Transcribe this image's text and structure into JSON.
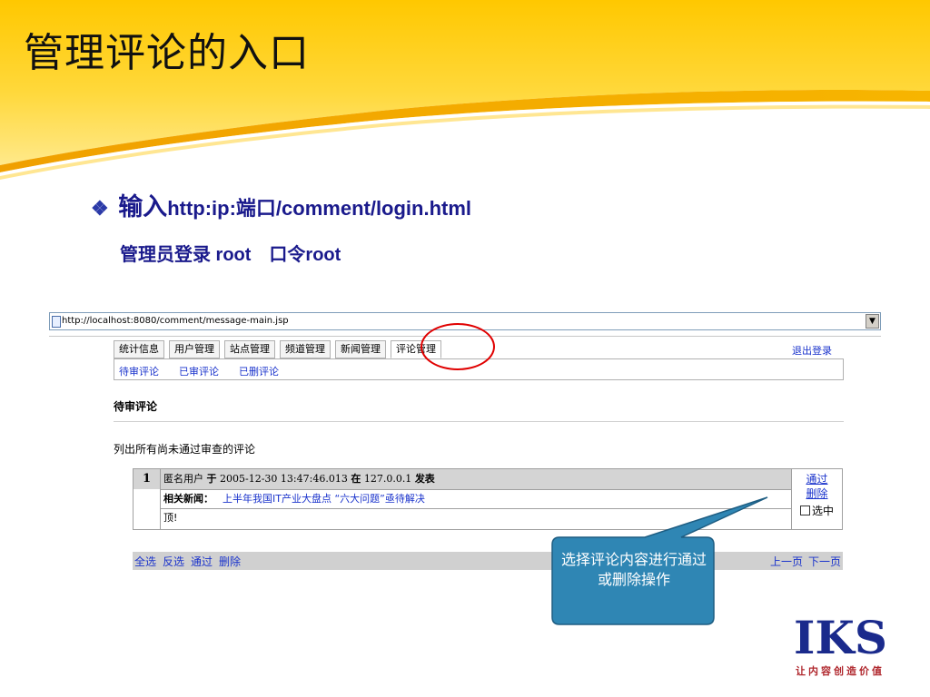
{
  "slide": {
    "title": "管理评论的入口",
    "bullet_word": "输入",
    "bullet_url": "http:ip:端口/comment/login.html",
    "admin_line": "管理员登录 root　口令root"
  },
  "browser": {
    "address": "http://localhost:8080/comment/message-main.jsp",
    "address_dropdown_glyph": "▼"
  },
  "tabs": [
    "统计信息",
    "用户管理",
    "站点管理",
    "频道管理",
    "新闻管理",
    "评论管理"
  ],
  "active_tab": "评论管理",
  "logout": "退出登录",
  "subnav": [
    "待审评论",
    "已审评论",
    "已删评论"
  ],
  "section": {
    "title": "待审评论",
    "desc": "列出所有尚未通过审查的评论"
  },
  "comment": {
    "number": "1",
    "user": "匿名用户",
    "at_word": "于",
    "time": "2005-12-30 13:47:46.013",
    "in_word": "在",
    "ip": "127.0.0.1",
    "post_word": "发表",
    "news_label": "相关新闻：",
    "news_title": "上半年我国IT产业大盘点 “六大问题”亟待解决",
    "body": "顶!",
    "approve": "通过",
    "delete": "删除",
    "select": "选中"
  },
  "bottom_bar": {
    "left": [
      "全选",
      "反选",
      "通过",
      "删除"
    ],
    "right": [
      "上一页",
      "下一页"
    ]
  },
  "callout": "选择评论内容进行通过或删除操作",
  "logo": {
    "letters": "IKS",
    "tagline": "让内容创造价值"
  },
  "colors": {
    "header_yellow": "#ffd21a",
    "header_orange": "#f5a000",
    "bullet_blue": "#1a1a8c",
    "link_blue": "#1a33cc",
    "callout_fill": "#2f86b4",
    "highlight_red": "#e00000",
    "logo_red": "#b0282e"
  }
}
